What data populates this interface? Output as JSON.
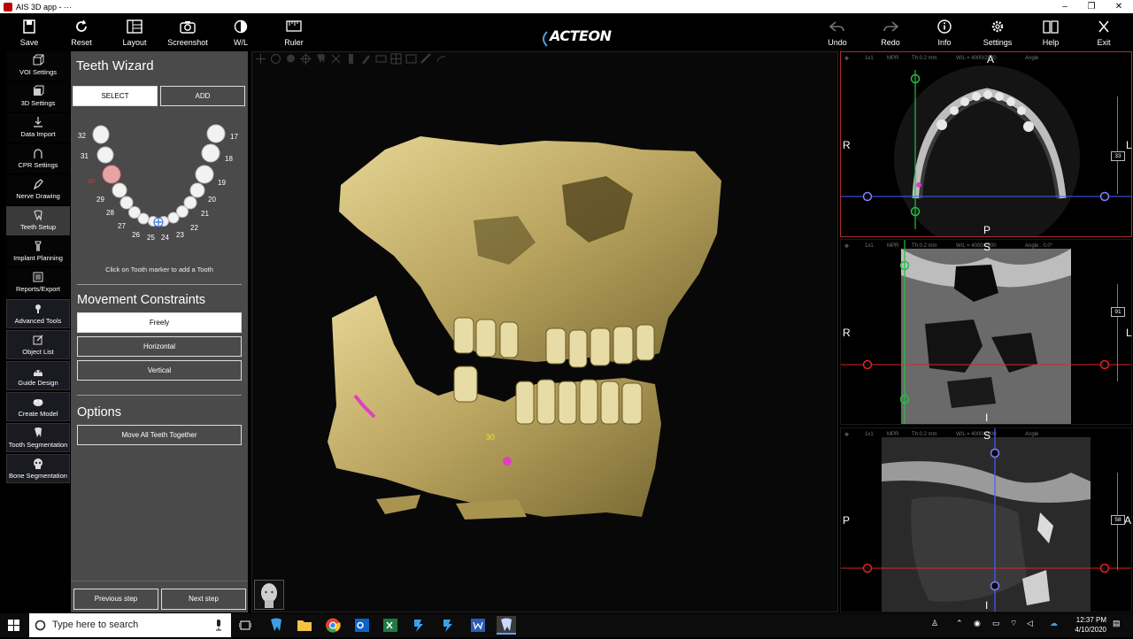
{
  "window": {
    "title": "AIS 3D app - ···",
    "minimize": "–",
    "maximize": "❐",
    "close": "✕"
  },
  "toolbar": {
    "save": "Save",
    "reset": "Reset",
    "layout": "Layout",
    "screenshot": "Screenshot",
    "wl": "W/L",
    "ruler": "Ruler",
    "undo": "Undo",
    "redo": "Redo",
    "info": "Info",
    "settings": "Settings",
    "help": "Help",
    "exit": "Exit",
    "brand": "ACTEON"
  },
  "sidebar": {
    "items": [
      {
        "label": "VOI Settings",
        "icon": "cube-icon"
      },
      {
        "label": "3D Settings",
        "icon": "cube-settings-icon"
      },
      {
        "label": "Data Import",
        "icon": "download-icon"
      },
      {
        "label": "CPR Settings",
        "icon": "arch-icon"
      },
      {
        "label": "Nerve Drawing",
        "icon": "pen-icon"
      },
      {
        "label": "Teeth Setup",
        "icon": "tooth-icon"
      },
      {
        "label": "Implant Planning",
        "icon": "implant-icon"
      },
      {
        "label": "Reports/Export",
        "icon": "report-icon"
      },
      {
        "label": "Advanced Tools",
        "icon": "tools-icon"
      },
      {
        "label": "Object List",
        "icon": "edit-list-icon"
      },
      {
        "label": "Guide Design",
        "icon": "guide-icon"
      },
      {
        "label": "Create Model",
        "icon": "model-icon"
      },
      {
        "label": "Tooth Segmentation",
        "icon": "tooth-seg-icon"
      },
      {
        "label": "Bone Segmentation",
        "icon": "skull-icon"
      }
    ],
    "active": "Teeth Setup"
  },
  "wizard": {
    "title": "Teeth Wizard",
    "select": "SELECT",
    "add": "ADD",
    "hint": "Click on Tooth marker to add a Tooth",
    "teeth_numbers": [
      "32",
      "31",
      "30",
      "29",
      "28",
      "27",
      "26",
      "25",
      "24",
      "23",
      "22",
      "21",
      "20",
      "19",
      "18",
      "17"
    ],
    "highlighted_tooth": "30",
    "movement_title": "Movement Constraints",
    "movement_options": [
      "Freely",
      "Horizontal",
      "Vertical"
    ],
    "movement_selected": "Freely",
    "options_title": "Options",
    "move_all": "Move All Teeth Together",
    "prev": "Previous step",
    "next": "Next step"
  },
  "view3d": {
    "tooth_marker": "30"
  },
  "panes": {
    "axial": {
      "zoom": "1x1",
      "mode": "MPR",
      "thickness": "Th:0.2 mm",
      "wl": "W/L = 4000/2000",
      "angle": "Angle",
      "top": "A",
      "bottom": "P",
      "left": "R",
      "right": "L",
      "slice": "33"
    },
    "coronal": {
      "zoom": "1x1",
      "mode": "MPR",
      "thickness": "Th:0.2 mm",
      "wl": "W/L = 4000/2000",
      "angle": "Angle : 0.0°",
      "top": "S",
      "bottom": "I",
      "left": "R",
      "right": "L",
      "slice": "91"
    },
    "sagittal": {
      "zoom": "1x1",
      "mode": "MPR",
      "thickness": "Th:0.2 mm",
      "wl": "W/L = 4000/2000",
      "angle": "Angle",
      "top": "S",
      "bottom": "I",
      "left": "P",
      "right": "A",
      "slice": "58"
    }
  },
  "taskbar": {
    "search_placeholder": "Type here to search",
    "time": "12:37 PM",
    "date": "4/10/2020"
  },
  "colors": {
    "panel": "#4a4a4a",
    "bone": "#c8b472",
    "red_axis": "#e02020",
    "green_axis": "#20c040",
    "blue_axis": "#4060ff",
    "marker": "#e040c0"
  }
}
